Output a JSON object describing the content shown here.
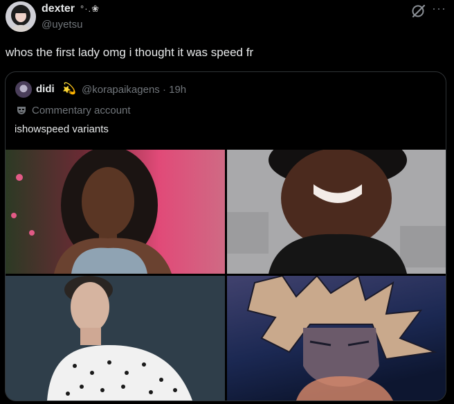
{
  "author": {
    "display_name": "dexter",
    "name_decor": "°·.❀",
    "handle": "@uyetsu"
  },
  "tweet_text": "whos the first lady omg i thought it was speed fr",
  "quoted": {
    "display_name": "didi",
    "emoji": "💫",
    "handle_time": "@korapaikagens · 19h",
    "label": "Commentary account",
    "text": "ishowspeed variants"
  },
  "icons": {
    "grok": "grok-icon",
    "more": "more-icon",
    "label": "mask-icon"
  },
  "more_glyph": "···",
  "colors": {
    "background": "#000000",
    "text": "#e7e9ea",
    "muted": "#71767b",
    "border": "#2f3336"
  }
}
